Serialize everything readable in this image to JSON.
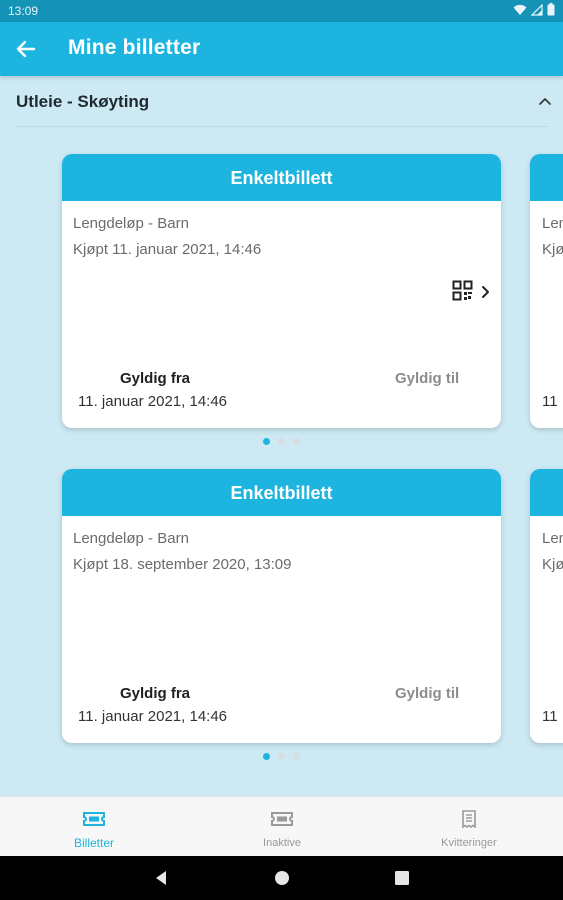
{
  "status_bar": {
    "time": "13:09"
  },
  "app_bar": {
    "title": "Mine billetter"
  },
  "section": {
    "title": "Utleie - Skøyting"
  },
  "groups": [
    {
      "ticket": {
        "type": "Enkeltbillett",
        "product": "Lengdeløp - Barn",
        "purchased": "Kjøpt 11. januar 2021, 14:46",
        "valid_from_label": "Gyldig fra",
        "valid_from": "11. januar 2021, 14:46",
        "valid_to_label": "Gyldig til"
      },
      "peek": {
        "line1": "Len",
        "line2": "Kjø",
        "line3": "11"
      },
      "pager": {
        "pages": 3,
        "active": 1
      }
    },
    {
      "ticket": {
        "type": "Enkeltbillett",
        "product": "Lengdeløp - Barn",
        "purchased": "Kjøpt 18. september 2020, 13:09",
        "valid_from_label": "Gyldig fra",
        "valid_from": "11. januar 2021, 14:46",
        "valid_to_label": "Gyldig til"
      },
      "peek": {
        "line1": "Len",
        "line2": "Kjø",
        "line3": "11"
      },
      "pager": {
        "pages": 3,
        "active": 1
      }
    }
  ],
  "bottom_nav": {
    "items": [
      {
        "label": "Billetter",
        "icon": "ticket-icon",
        "active": true
      },
      {
        "label": "Inaktive",
        "icon": "inactive-ticket-icon",
        "active": false
      },
      {
        "label": "Kvitteringer",
        "icon": "receipt-icon",
        "active": false
      }
    ]
  },
  "colors": {
    "primary": "#1eb4e0",
    "status_bar": "#1593b7",
    "background": "#cdeaf4"
  }
}
